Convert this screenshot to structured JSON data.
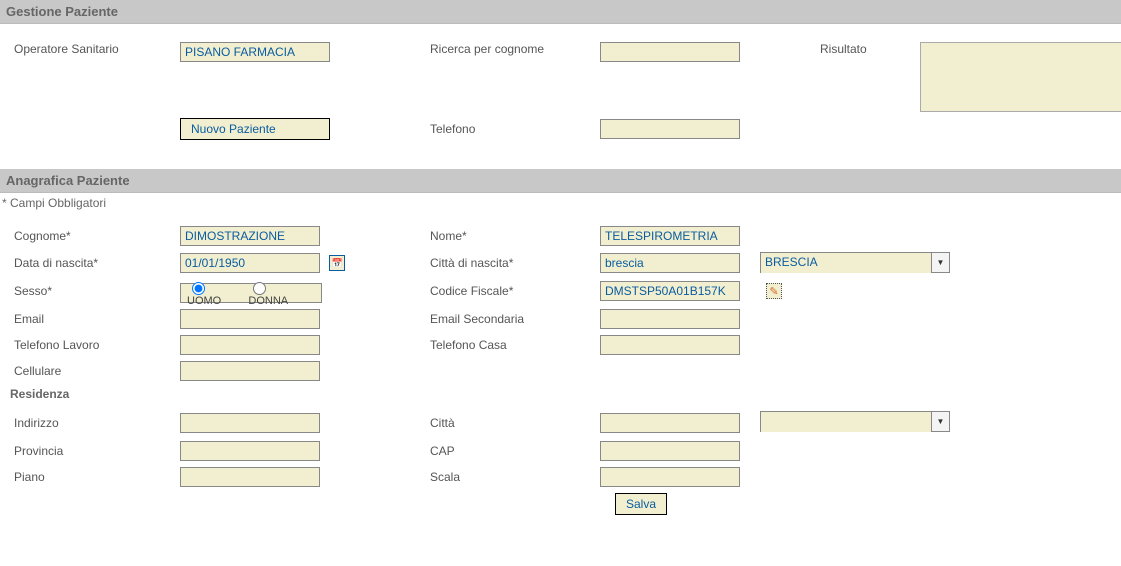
{
  "section1": {
    "title": "Gestione Paziente",
    "labels": {
      "operatore": "Operatore Sanitario",
      "ricerca_cognome": "Ricerca per cognome",
      "risultato": "Risultato",
      "telefono": "Telefono"
    },
    "fields": {
      "operatore": "PISANO FARMACIA",
      "ricerca_cognome": "",
      "telefono": ""
    },
    "buttons": {
      "nuovo": "Nuovo Paziente"
    }
  },
  "section2": {
    "title": "Anagrafica Paziente",
    "note": "* Campi Obbligatori",
    "labels": {
      "cognome": "Cognome*",
      "nome": "Nome*",
      "data_nascita": "Data di nascita*",
      "citta_nascita": "Città di nascita*",
      "sesso": "Sesso*",
      "cf": "Codice Fiscale*",
      "email": "Email",
      "email2": "Email Secondaria",
      "tel_lavoro": "Telefono Lavoro",
      "tel_casa": "Telefono Casa",
      "cellulare": "Cellulare",
      "residenza": "Residenza",
      "indirizzo": "Indirizzo",
      "citta": "Città",
      "provincia": "Provincia",
      "cap": "CAP",
      "piano": "Piano",
      "scala": "Scala"
    },
    "fields": {
      "cognome": "DIMOSTRAZIONE",
      "nome": "TELESPIROMETRIA",
      "data_nascita": "01/01/1950",
      "citta_nascita_input": "brescia",
      "citta_nascita_combo": "BRESCIA",
      "cf": "DMSTSP50A01B157K",
      "email": "",
      "email2": "",
      "tel_lavoro": "",
      "tel_casa": "",
      "cellulare": "",
      "indirizzo": "",
      "citta_input": "",
      "citta_combo": "",
      "provincia": "",
      "cap": "",
      "piano": "",
      "scala": ""
    },
    "radio": {
      "uomo": "UOMO",
      "donna": "DONNA",
      "selected": "uomo"
    },
    "buttons": {
      "salva": "Salva"
    }
  }
}
